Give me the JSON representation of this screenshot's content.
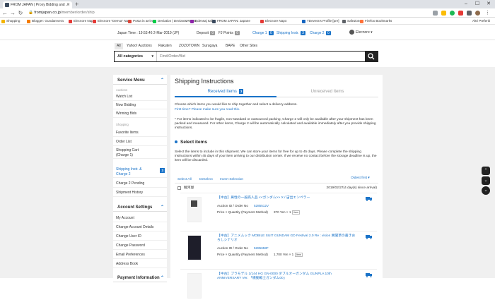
{
  "browser": {
    "tab_title": "FROM JAPAN | Proxy Bidding and ...",
    "url_host": "fromjapan.co.jp",
    "url_path": "/member/order/ship",
    "bookmarks": [
      "Shopping",
      "Blogger: Gundamvera",
      "Elecnore Napo",
      "Elecnore \"Deeva\" Nap",
      "Posta in arrivo",
      "Deviation | Deviant&#8230;",
      "Edensaj Italia",
      "FROM JAPAN: Japane",
      "Elecnore Napo",
      "TDevera's Profile [pre]",
      "SafeZone",
      "Firefox Bookmarks"
    ],
    "bookmark_colors": [
      "#f4b400",
      "#f57c00",
      "#e53935",
      "#e53935",
      "#db4437",
      "#05cc47",
      "#8e24aa",
      "#3b4a5e",
      "#e53935",
      "#1565c0",
      "#5f6368",
      "#ff7139"
    ],
    "other_bookmarks": "Altri Preferiti"
  },
  "header": {
    "japan_time": "Japan Time : 19:53:46 2-Mar-2019 (JP)",
    "deposit_label": "Deposit",
    "deposit_value": "0",
    "fj_points_label": "FJ Points",
    "fj_points_value": "0",
    "charge1_label": "Charge 1",
    "charge1_value": "0",
    "shipping_label": "Shipping Instr.",
    "shipping_value": "3",
    "charge2_label": "Charge 2",
    "charge2_value": "0",
    "user_name": "Elecnore"
  },
  "site_tabs": [
    "All",
    "Yahoo! Auctions",
    "Rakuten",
    "ZOZOTOWN",
    "Surugaya",
    "BAPE",
    "Other Sites"
  ],
  "search": {
    "category": "All categories",
    "placeholder": "Find/Order/Bid"
  },
  "sidebar": {
    "service_menu_title": "Service Menu",
    "auctions_label": "Auctions",
    "auction_items": [
      "Watch List",
      "Now Bidding",
      "Winning Bids"
    ],
    "shopping_label": "Shopping",
    "shopping_items": [
      "Favorite Items",
      "Order List",
      "Shopping Cart",
      "(Charge 1)"
    ],
    "shipping_instr": "Shipping Instr. &",
    "shipping_instr2": "Charge 2",
    "shipping_count": "3",
    "more_items": [
      "Charge 2 Pending",
      "Shipment History"
    ],
    "account_title": "Account Settings",
    "account_items": [
      "My Account",
      "Change Account Details",
      "Change User ID",
      "Change Password",
      "Email Preferences",
      "Address Book"
    ],
    "payment_title": "Payment Information"
  },
  "main": {
    "title": "Shipping Instructions",
    "tab_received": "Received Items",
    "tab_received_count": "3",
    "tab_unreceived": "Unreceived Items",
    "intro1": "Choose which items you would like to ship together and select a delivery address.",
    "intro_link": "First time? Please make sure you read this.",
    "note": "* For items indicated to be fragile, non-standard or outsourced packing, Charge 2 will only be available after your shipment has been packed and measured. For other items, Charge 2 will be automatically calculated and available immediately after you provide shipping instructions.",
    "select_title": "Select items",
    "select_desc": "Select the items to include in this shipment. We can store your items for free for up to 45 days. Please complete the shipping instructions within 45 days of your item arriving to our distribution center. If we receive no contact before the storage deadline is up, the item will be discarded.",
    "select_all": "Select All",
    "deselect": "Deselect",
    "invert": "Invert Selection",
    "sort": "Oldest first",
    "group_name": "駿河屋",
    "group_date": "2019/02/27(4 day(s) since arrival)",
    "items": [
      {
        "title": "【中古】男性の一般売人品 <<ガンダム>> X / 宙出エンペラー",
        "auction_label": "Auction ID / Order No",
        "auction_value": "5285512V",
        "price_label": "Price × Quantity (Payment Method)",
        "price_value": "370 Yen × 1",
        "badge": "Item"
      },
      {
        "title": "【中古】アニメムック MOBILE SUIT GUNDAM GD Festival 2.0 Re : vision 異聞草の書きおろしシナリオ",
        "auction_label": "Auction ID / Order No",
        "auction_value": "5285658F",
        "price_label": "Price × Quantity (Payment Method)",
        "price_value": "1,700 Yen × 1",
        "badge": "Item"
      },
      {
        "title": "【中古】プラモデル 1/144 HG GN-0000 ダブルオーガンダム GUNPLA 10th ANNIVERSARY Ver. 「機動戦士ガンダム00」"
      }
    ]
  }
}
